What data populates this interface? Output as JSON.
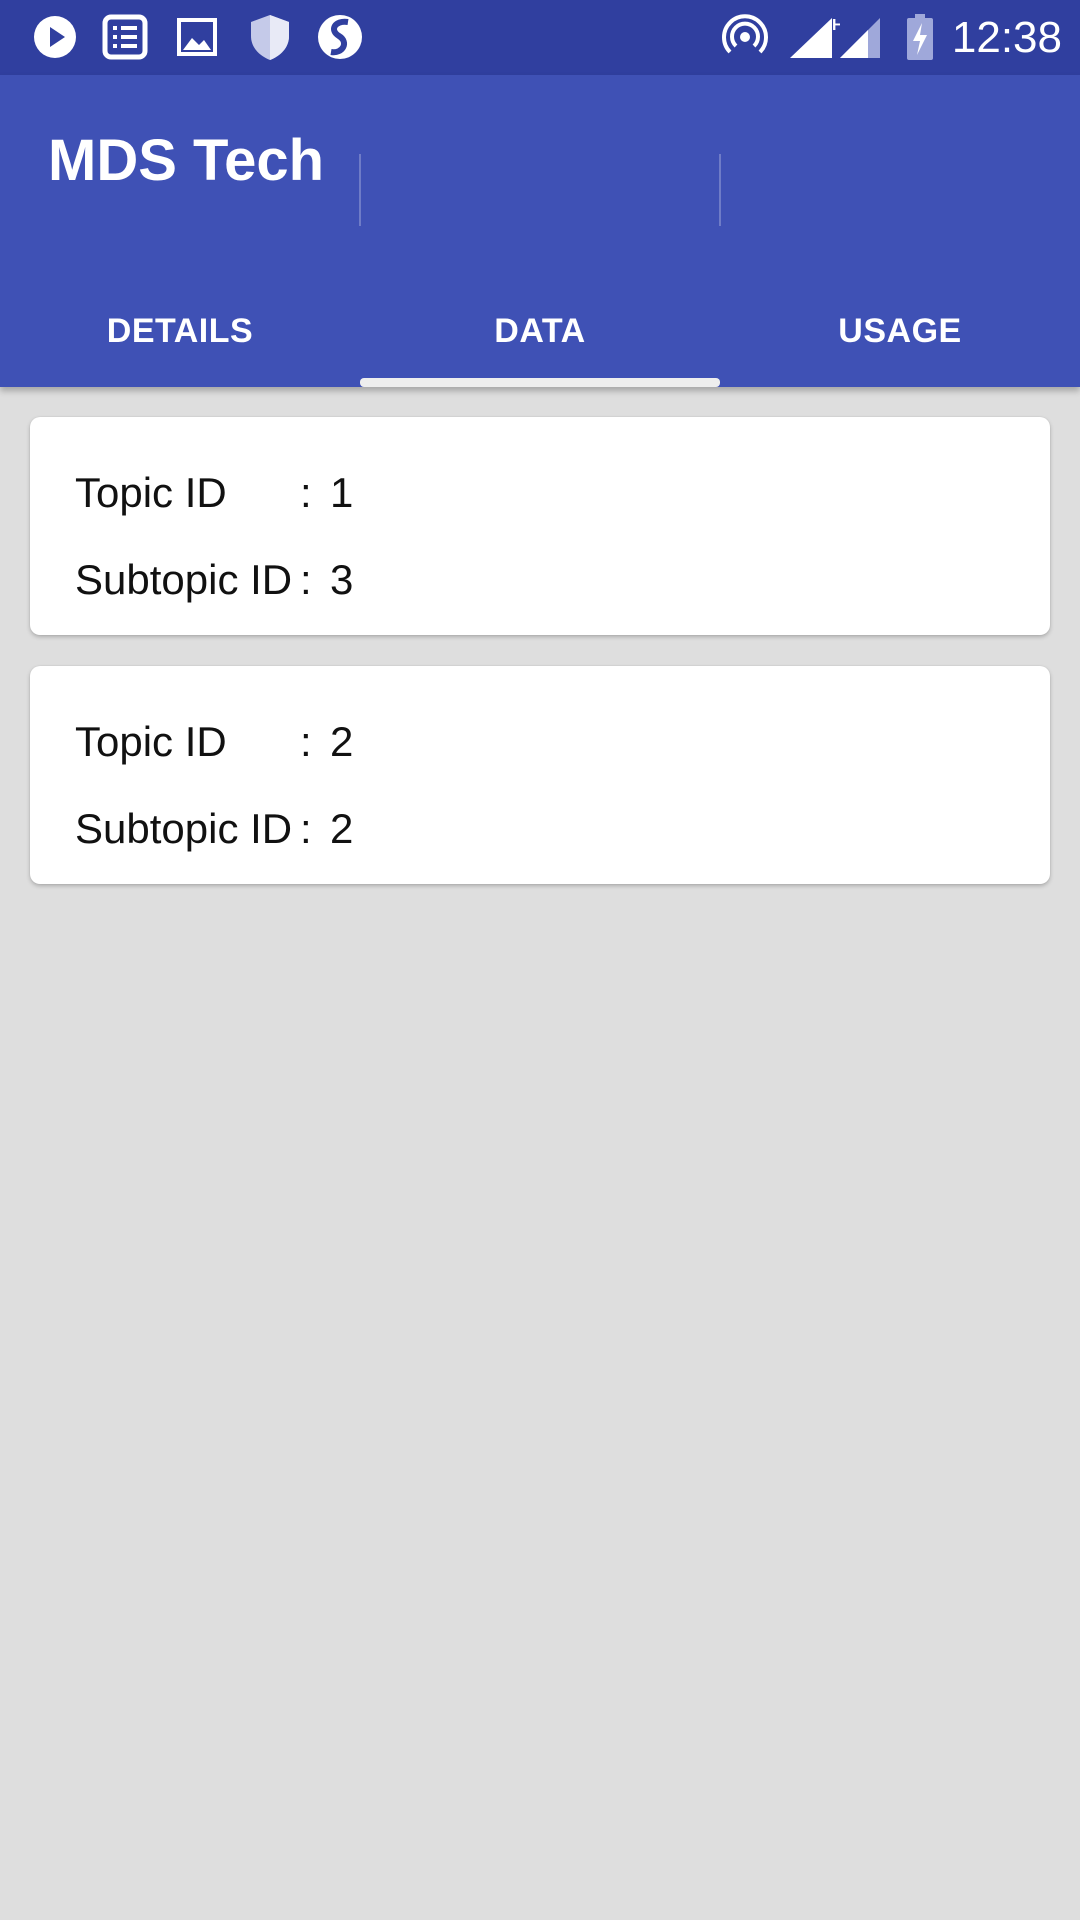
{
  "status_bar": {
    "time": "12:38",
    "icons": [
      "play-icon",
      "checklist-icon",
      "image-icon",
      "shield-icon",
      "s-app-icon",
      "hotspot-icon",
      "signal-h-icon",
      "signal-icon",
      "battery-charging-icon"
    ]
  },
  "app_bar": {
    "title": "MDS Tech",
    "color": "#3f51b5",
    "status_color": "#303f9f"
  },
  "tabs": [
    {
      "label": "DETAILS",
      "selected": false
    },
    {
      "label": "DATA",
      "selected": true
    },
    {
      "label": "USAGE",
      "selected": false
    }
  ],
  "records": [
    {
      "topic_label": "Topic ID",
      "topic_sep": ":",
      "topic_value": "1",
      "subtopic_label": "Subtopic ID",
      "subtopic_sep": ":",
      "subtopic_value": "3"
    },
    {
      "topic_label": "Topic ID",
      "topic_sep": ":",
      "topic_value": "2",
      "subtopic_label": "Subtopic ID",
      "subtopic_sep": ":",
      "subtopic_value": "2"
    }
  ]
}
